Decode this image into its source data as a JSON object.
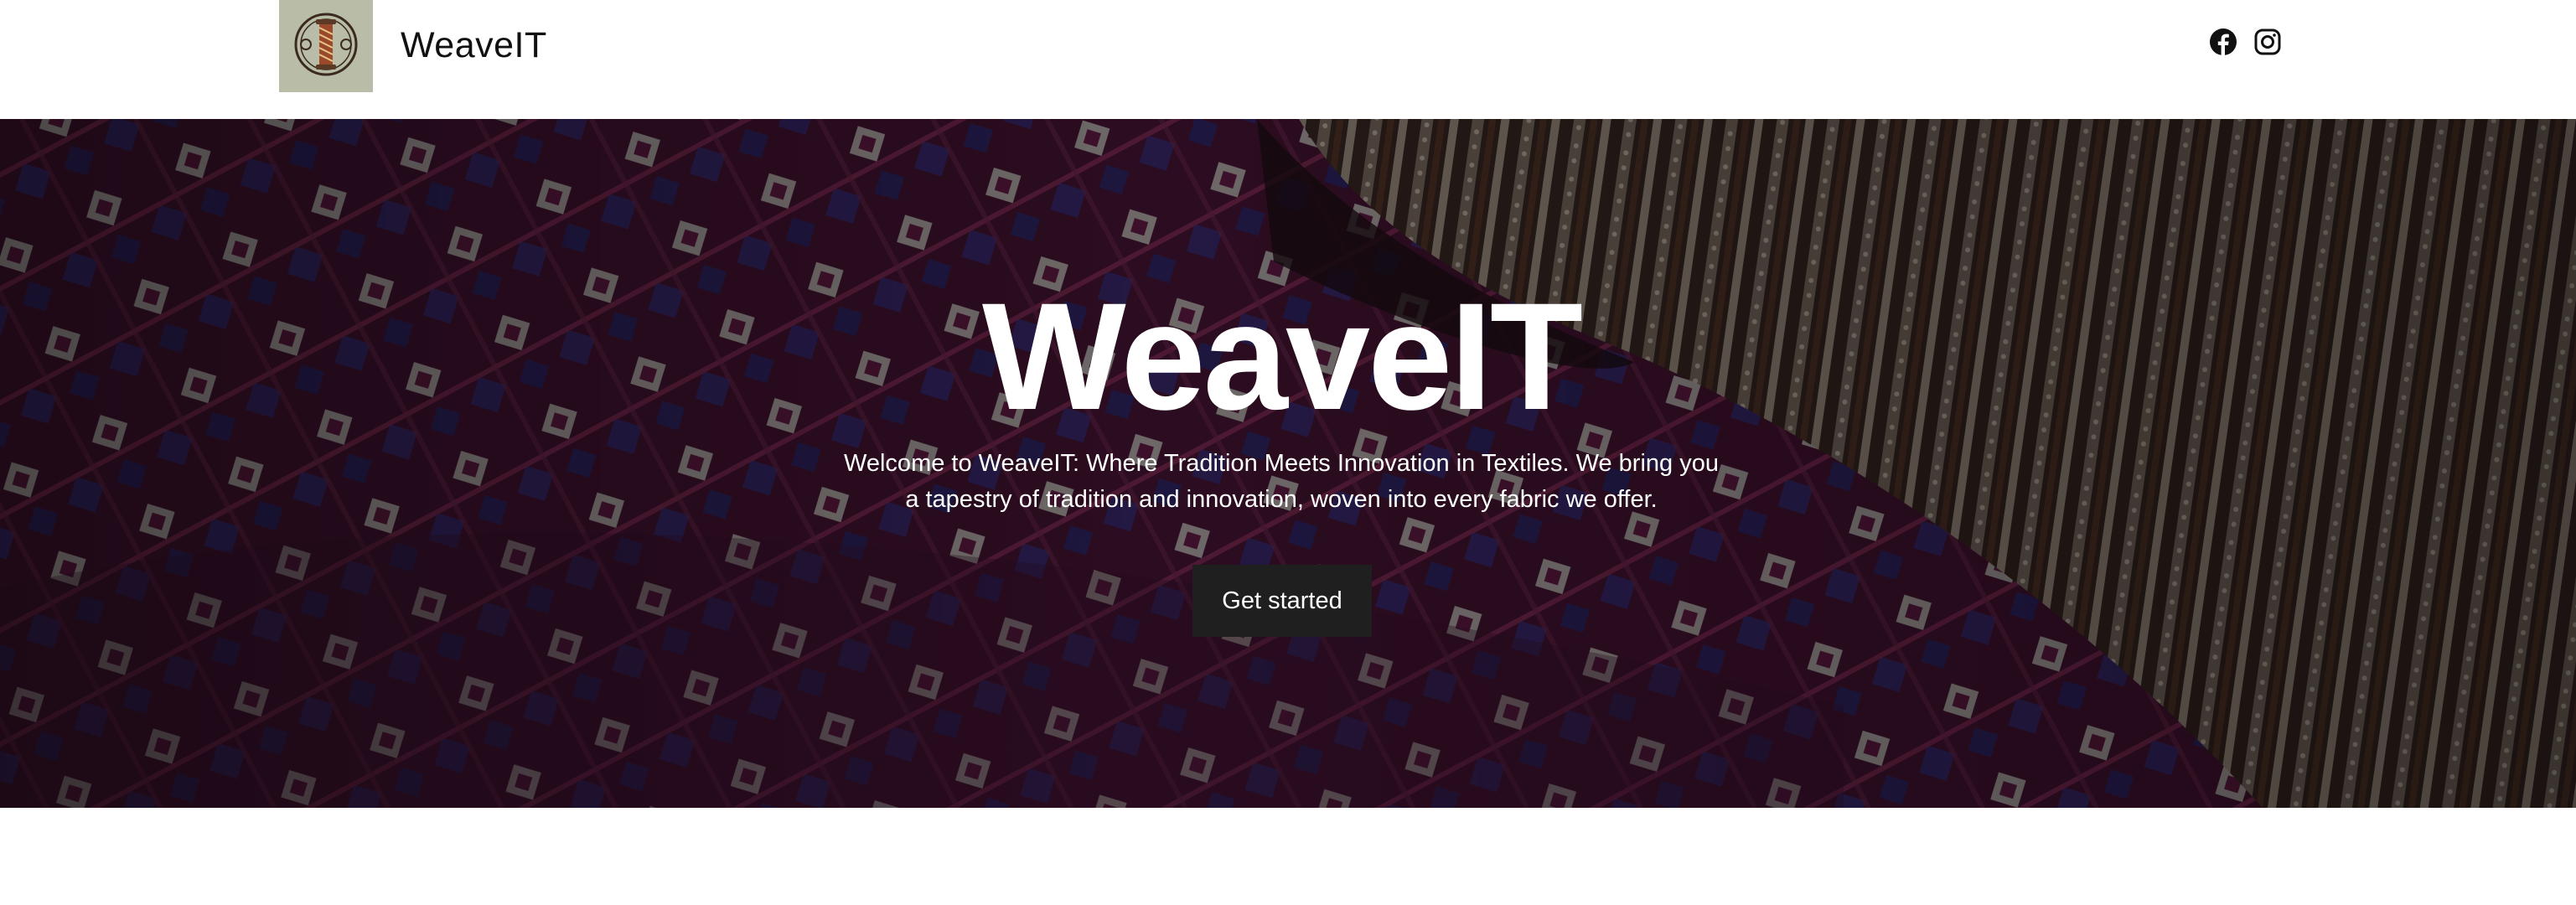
{
  "header": {
    "brand": "WeaveIT",
    "logo_icon": "spool-icon",
    "social": [
      {
        "name": "facebook-icon"
      },
      {
        "name": "instagram-icon"
      }
    ]
  },
  "hero": {
    "title": "WeaveIT",
    "text": "Welcome to WeaveIT: Where Tradition Meets Innovation in Textiles. We bring you a tapestry of tradition and innovation, woven into every fabric we offer.",
    "button_label": "Get started"
  },
  "colors": {
    "header_bg": "#ffffff",
    "logo_bg": "#b9bca6",
    "button_bg": "#1f1f1f",
    "hero_text": "#ffffff"
  }
}
